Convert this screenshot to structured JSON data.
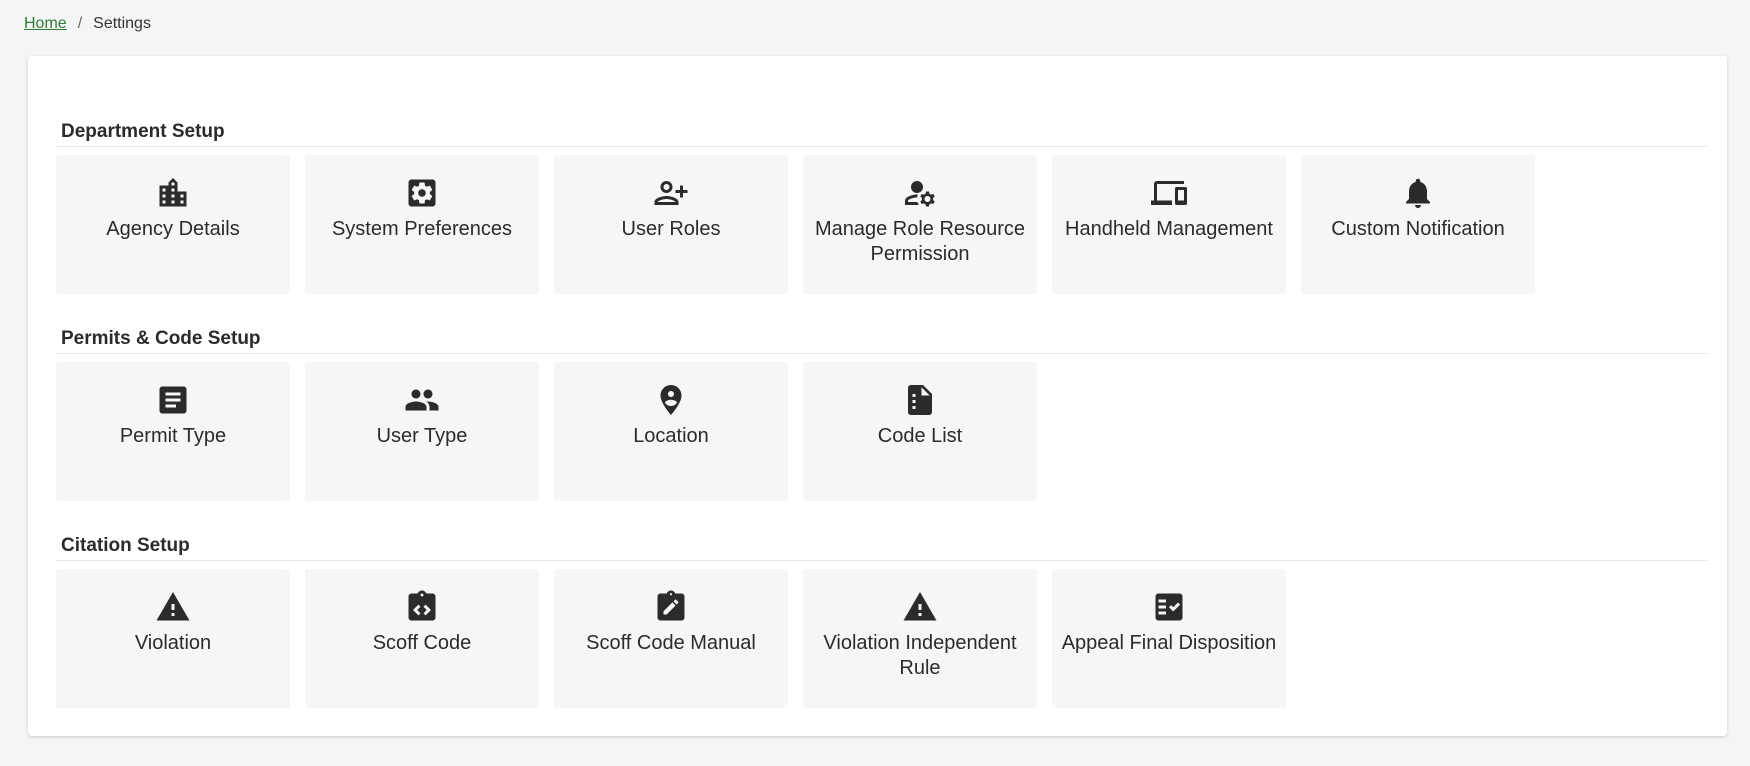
{
  "breadcrumb": {
    "home": "Home",
    "separator": "/",
    "current": "Settings"
  },
  "sections": [
    {
      "title": "Department Setup",
      "tiles": [
        {
          "label": "Agency Details",
          "icon": "building-icon"
        },
        {
          "label": "System Preferences",
          "icon": "settings-gear-icon"
        },
        {
          "label": "User Roles",
          "icon": "person-add-icon"
        },
        {
          "label": "Manage Role Resource Permission",
          "icon": "person-gear-icon"
        },
        {
          "label": "Handheld Management",
          "icon": "devices-icon"
        },
        {
          "label": "Custom Notification",
          "icon": "bell-icon"
        }
      ]
    },
    {
      "title": "Permits & Code Setup",
      "tiles": [
        {
          "label": "Permit Type",
          "icon": "article-icon"
        },
        {
          "label": "User Type",
          "icon": "people-icon"
        },
        {
          "label": "Location",
          "icon": "location-pin-icon"
        },
        {
          "label": "Code List",
          "icon": "note-list-icon"
        }
      ]
    },
    {
      "title": "Citation Setup",
      "tiles": [
        {
          "label": "Violation",
          "icon": "warning-icon"
        },
        {
          "label": "Scoff Code",
          "icon": "clipboard-code-icon"
        },
        {
          "label": "Scoff Code Manual",
          "icon": "clipboard-edit-icon"
        },
        {
          "label": "Violation Independent Rule",
          "icon": "warning-icon"
        },
        {
          "label": "Appeal Final Disposition",
          "icon": "checklist-icon"
        }
      ]
    }
  ],
  "colors": {
    "link": "#2e7d32",
    "tile_bg": "#f5f6f8",
    "icon": "#2b2b2b"
  }
}
